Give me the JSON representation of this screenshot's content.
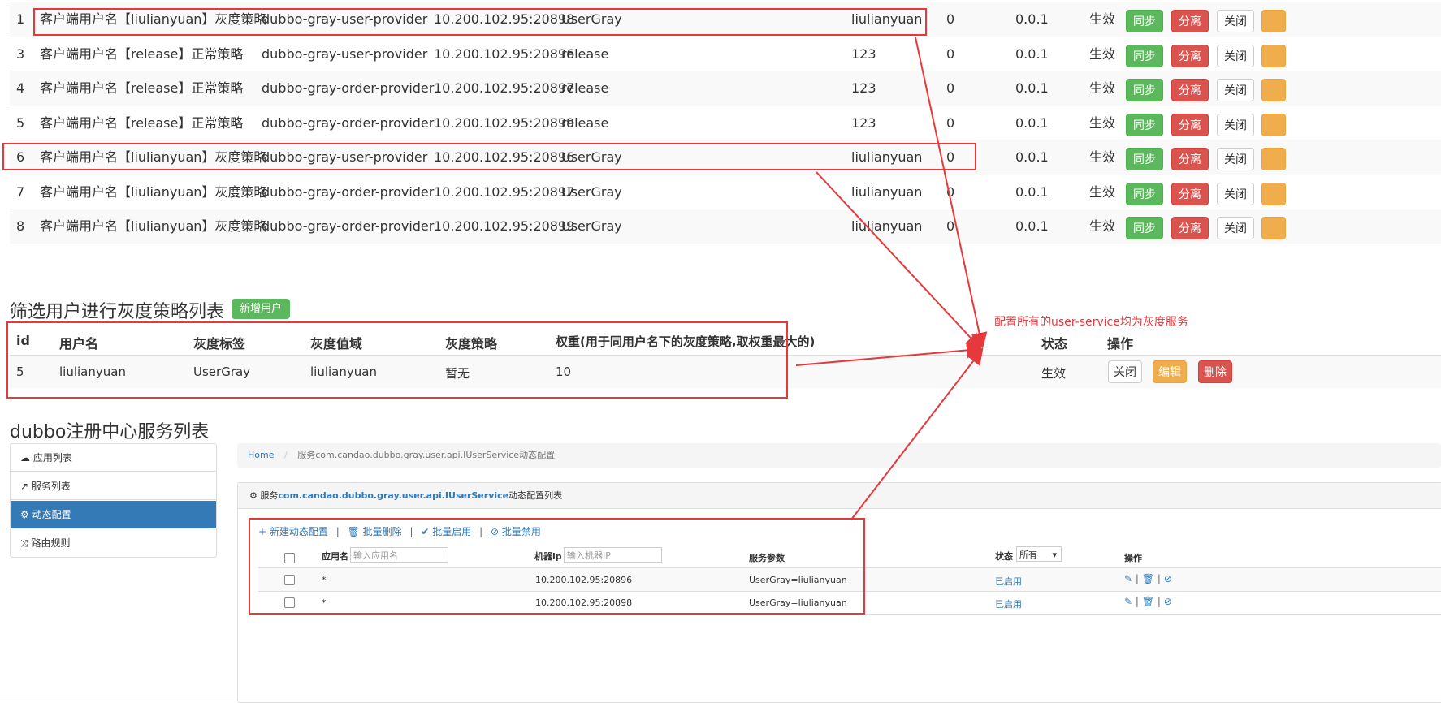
{
  "strategy_rows": [
    {
      "id": "1",
      "name": "客户端用户名【liulianyuan】灰度策略",
      "service": "dubbo-gray-user-provider",
      "addr": "10.200.102.95:20898",
      "tag": "UserGray",
      "value": "liulianyuan",
      "weight": "0",
      "version": "0.0.1",
      "status": "生效"
    },
    {
      "id": "3",
      "name": "客户端用户名【release】正常策略",
      "service": "dubbo-gray-user-provider",
      "addr": "10.200.102.95:20896",
      "tag": "release",
      "value": "123",
      "weight": "0",
      "version": "0.0.1",
      "status": "生效"
    },
    {
      "id": "4",
      "name": "客户端用户名【release】正常策略",
      "service": "dubbo-gray-order-provider",
      "addr": "10.200.102.95:20897",
      "tag": "release",
      "value": "123",
      "weight": "0",
      "version": "0.0.1",
      "status": "生效"
    },
    {
      "id": "5",
      "name": "客户端用户名【release】正常策略",
      "service": "dubbo-gray-order-provider",
      "addr": "10.200.102.95:20899",
      "tag": "release",
      "value": "123",
      "weight": "0",
      "version": "0.0.1",
      "status": "生效"
    },
    {
      "id": "6",
      "name": "客户端用户名【liulianyuan】灰度策略",
      "service": "dubbo-gray-user-provider",
      "addr": "10.200.102.95:20896",
      "tag": "UserGray",
      "value": "liulianyuan",
      "weight": "0",
      "version": "0.0.1",
      "status": "生效"
    },
    {
      "id": "7",
      "name": "客户端用户名【liulianyuan】灰度策略",
      "service": "dubbo-gray-order-provider",
      "addr": "10.200.102.95:20897",
      "tag": "UserGray",
      "value": "liulianyuan",
      "weight": "0",
      "version": "0.0.1",
      "status": "生效"
    },
    {
      "id": "8",
      "name": "客户端用户名【liulianyuan】灰度策略",
      "service": "dubbo-gray-order-provider",
      "addr": "10.200.102.95:20899",
      "tag": "UserGray",
      "value": "liulianyuan",
      "weight": "0",
      "version": "0.0.1",
      "status": "生效"
    }
  ],
  "row_buttons": {
    "sync": "同步",
    "split": "分离",
    "close": "关闭"
  },
  "user_section": {
    "title": "筛选用户进行灰度策略列表",
    "add_button": "新增用户",
    "headers": {
      "id": "id",
      "username": "用户名",
      "tag": "灰度标签",
      "domain": "灰度值域",
      "strategy": "灰度策略",
      "weight": "权重(用于同用户名下的灰度策略,取权重最大的)",
      "status": "状态",
      "ops": "操作"
    },
    "row": {
      "id": "5",
      "username": "liulianyuan",
      "tag": "UserGray",
      "domain": "liulianyuan",
      "strategy": "暂无",
      "weight": "10",
      "status": "生效"
    },
    "buttons": {
      "close": "关闭",
      "edit": "编辑",
      "delete": "删除"
    }
  },
  "annotation": "配置所有的user-service均为灰度服务",
  "dubbo": {
    "title": "dubbo注册中心服务列表",
    "sidebar": [
      {
        "label": "应用列表",
        "icon": "cloud-icon"
      },
      {
        "label": "服务列表",
        "icon": "share-icon"
      },
      {
        "label": "动态配置",
        "icon": "cogs-icon"
      },
      {
        "label": "路由规则",
        "icon": "random-icon"
      }
    ],
    "breadcrumb": {
      "home": "Home",
      "sep": "/",
      "current": "服务com.candao.dubbo.gray.user.api.IUserService动态配置"
    },
    "panel_title": {
      "prefix": "服务",
      "service": "com.candao.dubbo.gray.user.api.IUserService",
      "suffix": "动态配置列表"
    },
    "actions": {
      "new": "新建动态配置",
      "batch_delete": "批量删除",
      "batch_enable": "批量启用",
      "batch_disable": "批量禁用"
    },
    "headers": {
      "app": "应用名",
      "app_placeholder": "输入应用名",
      "ip": "机器ip",
      "ip_placeholder": "输入机器IP",
      "params": "服务参数",
      "status": "状态",
      "status_value": "所有",
      "ops": "操作"
    },
    "rows": [
      {
        "app": "*",
        "ip": "10.200.102.95:20896",
        "params": "UserGray=liulianyuan",
        "status": "已启用"
      },
      {
        "app": "*",
        "ip": "10.200.102.95:20898",
        "params": "UserGray=liulianyuan",
        "status": "已启用"
      }
    ]
  },
  "colors": {
    "accent_red": "#e5393c",
    "link": "#337ab7",
    "active": "#337ab7",
    "green": "#5cb85c",
    "danger": "#d9534f",
    "warning": "#f0ad4e"
  }
}
